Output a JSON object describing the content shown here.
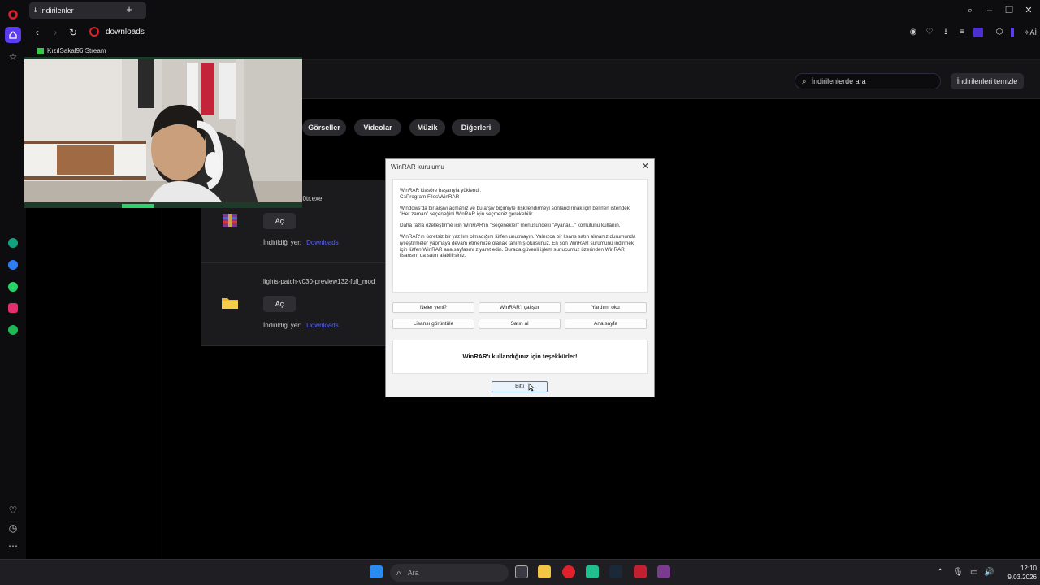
{
  "browser": {
    "tab_title": "İndirilenler",
    "url": "downloads",
    "bookmark": "KızılSakal96 Stream"
  },
  "downloads": {
    "search_placeholder": "İndirilenlerde ara",
    "clear_label": "İndirilenleri temizle",
    "filters": [
      "Görseller",
      "Videolar",
      "Müzik",
      "Diğerleri"
    ],
    "items": [
      {
        "name": "20tr.exe",
        "open_label": "Aç",
        "location_label": "İndirildiği yer:",
        "location_link": "Downloads"
      },
      {
        "name": "lights-patch-v030-preview132-full_mod",
        "open_label": "Aç",
        "location_label": "İndirildiği yer:",
        "location_link": "Downloads"
      }
    ]
  },
  "dialog": {
    "title": "WinRAR kurulumu",
    "para1_line1": "WinRAR klasöre başarıyla yüklendi:",
    "para1_line2": "C:\\Program Files\\WinRAR",
    "para2": "Windows'da bir arşivi açmanız ve bu arşiv biçimiyle ilişkilendirmeyi sonlandırmak için belirlen istendeki \"Her zaman\" seçeneğini WinRAR için seçmeniz gerekebilir.",
    "para3": "Daha fazla özelleştirme için WinRAR'ın \"Seçenekler\" menüsündeki \"Ayarlar...\" komutunu kullanın.",
    "para4": "WinRAR'ın ücretsiz bir yazılım olmadığını lütfen unutmayın. Yalnızca bir lisans satın almanız durumunda iyileştirmeler yapmaya devam etmemize olanak tanımış olursunuz. En son WinRAR sürümünü indirmek için lütfen WinRAR ana sayfasını ziyaret edin. Burada güvenli işlem sunucumuz üzerinden WinRAR lisansını da satın alabilirsiniz.",
    "buttons": [
      "Neler yeni?",
      "WinRAR'ı çalıştır",
      "Yardımı oku",
      "Lisansı görüntüle",
      "Satın al",
      "Ana sayfa"
    ],
    "thanks": "WinRAR'ı kullandığınız için teşekkürler!",
    "done": "Bitti"
  },
  "taskbar": {
    "search_placeholder": "Ara",
    "time": "12:10",
    "date": "9.03.2026"
  }
}
